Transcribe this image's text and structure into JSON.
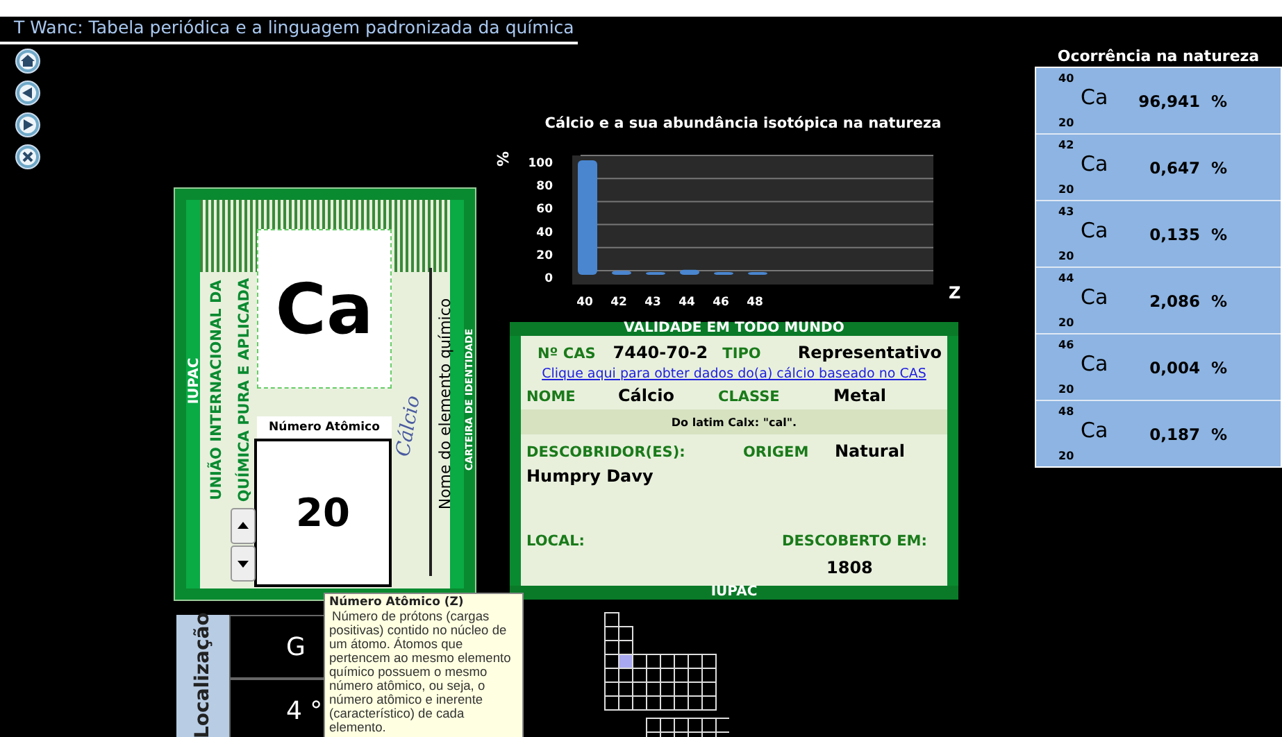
{
  "window": {
    "title": "T Wanc: Tabela periódica e a linguagem padronizada da química"
  },
  "nav_buttons": [
    {
      "kind": "home"
    },
    {
      "kind": "back"
    },
    {
      "kind": "forward"
    },
    {
      "kind": "close"
    }
  ],
  "chart": {
    "chart_data": {
      "type": "bar",
      "title": "Cálcio e a sua abundância  isotópica na natureza",
      "ylabel": "%",
      "categories": [
        "40",
        "42",
        "43",
        "44",
        "46",
        "48"
      ],
      "values": [
        97,
        1,
        0,
        2,
        0,
        0
      ],
      "ylim": [
        0,
        100
      ],
      "yticks": [
        0,
        20,
        40,
        60,
        80,
        100
      ],
      "grid": true,
      "annotations": [
        {
          "text": "Z"
        }
      ]
    }
  },
  "id_card": {
    "side_label": "IUPAC",
    "org_lines": [
      "UNIÃO INTERNACIONAL DA",
      "QUÍMICA PURA E APLICADA"
    ],
    "symbol": "Ca",
    "atomic_number_label": "Número Atômico",
    "atomic_number": "20",
    "element_signature": "Cálcio",
    "name_caption": "Nome do elemento químico",
    "card_caption": "CARTEIRA DE IDENTIDADE"
  },
  "details_card": {
    "header": "VALIDADE EM TODO MUNDO",
    "cas_label": "Nº CAS",
    "cas": "7440-70-2",
    "type_label": "TIPO",
    "type": "Representativo",
    "link": "Clique aqui para obter dados do(a) cálcio baseado no CAS",
    "name_label": "NOME",
    "name": "Cálcio",
    "class_label": "CLASSE",
    "class": "Metal",
    "etymology": "Do latim Calx: \"cal\".",
    "discoverer_label": "DESCOBRIDOR(ES):",
    "origin_label": "ORIGEM",
    "origin": "Natural",
    "discoverer": "Humpry Davy",
    "place_label": "LOCAL:",
    "discovered_label": "DESCOBERTO EM:",
    "discovered": "1808",
    "footer": "IUPAC"
  },
  "occurrence": {
    "title": "Ocorrência na natureza",
    "rows": [
      {
        "mass": "40",
        "symbol": "Ca",
        "number": "20",
        "value": "96,941",
        "unit": "%"
      },
      {
        "mass": "42",
        "symbol": "Ca",
        "number": "20",
        "value": "0,647",
        "unit": "%"
      },
      {
        "mass": "43",
        "symbol": "Ca",
        "number": "20",
        "value": "0,135",
        "unit": "%"
      },
      {
        "mass": "44",
        "symbol": "Ca",
        "number": "20",
        "value": "2,086",
        "unit": "%"
      },
      {
        "mass": "46",
        "symbol": "Ca",
        "number": "20",
        "value": "0,004",
        "unit": "%"
      },
      {
        "mass": "48",
        "symbol": "Ca",
        "number": "20",
        "value": "0,187",
        "unit": "%"
      }
    ]
  },
  "location": {
    "label": "Localização",
    "cells": [
      "G",
      "4 °"
    ]
  },
  "tooltip": {
    "title": "Número Atômico (Z)",
    "text": "Número de prótons (cargas positivas) contido no núcleo de um átomo. Átomos que pertencem ao mesmo elemento químico possuem o mesmo número atômico, ou seja, o número atômico e inerente (característico) de cada elemento."
  }
}
